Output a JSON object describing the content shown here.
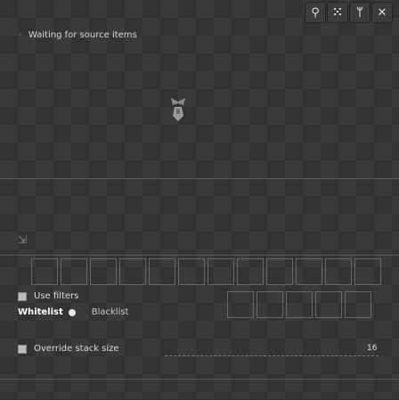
{
  "title_bar": {
    "buttons": [
      {
        "name": "search-button",
        "glyph": "⚲"
      },
      {
        "name": "dots-button",
        "glyph": "⁙"
      },
      {
        "name": "fork-button",
        "glyph": "ᛘ"
      },
      {
        "name": "close-button",
        "glyph": "✕"
      }
    ]
  },
  "status": {
    "text": "Waiting for source items"
  },
  "filters": {
    "use_filters_label": "Use filters",
    "whitelist_label": "Whitelist",
    "blacklist_label": "Blacklist"
  },
  "override": {
    "label": "Override stack size",
    "value": "16"
  },
  "colors": {
    "background": "#2e2e2e",
    "checker": "#3a3a3a",
    "text": "#dcdcdc"
  }
}
